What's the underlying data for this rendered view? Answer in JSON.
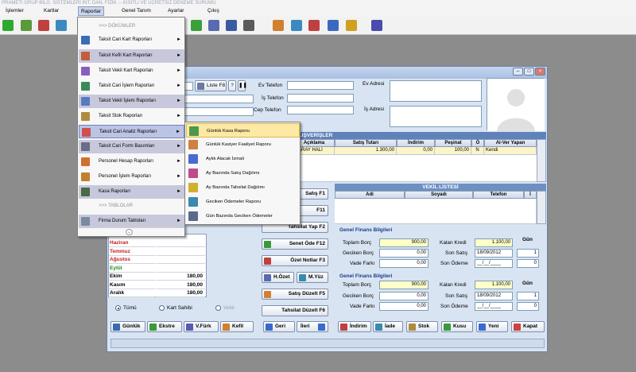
{
  "app": {
    "title": "PRAMETI GRUP BİLG. SİSTEMLERİ İNT. DAN. FİZM.  --  KISITLI VE ÜCRETSİZ DENEME SÜRÜMÜ"
  },
  "menubar": {
    "items": [
      "İşlemler",
      "Kartlar",
      "Raporlar",
      "Genel Tanım",
      "Ayarlar",
      "Çıkış"
    ]
  },
  "dropdown": {
    "items": [
      {
        "label": ">>> DÖKÜMLER",
        "type": "section"
      },
      {
        "label": "Taksit Cari Kart Raporları",
        "arrow": "►",
        "icon": "person-card-icon",
        "color": "#3a6db8"
      },
      {
        "label": "Taksit Kefil Kart Raporları",
        "arrow": "►",
        "icon": "people-icon",
        "color": "#c0603a"
      },
      {
        "label": "Taksit Vekil Kart Raporları",
        "arrow": "►",
        "icon": "person-icon",
        "color": "#8a5cc0"
      },
      {
        "label": "Taksit Cari İşlem Raporları",
        "arrow": "►",
        "icon": "transaction-icon",
        "color": "#3a8a5a"
      },
      {
        "label": "Taksit Vekil İşlem Raporları",
        "arrow": "►",
        "icon": "person-transaction-icon",
        "color": "#5a7ac0"
      },
      {
        "label": "Taksit Stok Raporları",
        "arrow": "►",
        "icon": "box-icon",
        "color": "#b08a40"
      },
      {
        "label": "Taksit Cari Analiz Raporları",
        "arrow": "►",
        "icon": "bar-chart-icon",
        "color": "#d05050"
      },
      {
        "label": "Taksit Cari Form Basımları",
        "arrow": "►",
        "icon": "printer-icon",
        "color": "#6b6b8a"
      },
      {
        "label": "Personel Hesap Raporları",
        "arrow": "►",
        "icon": "staff-icon",
        "color": "#d07030"
      },
      {
        "label": "Personel İşlem Raporları",
        "arrow": "►",
        "icon": "staff-transaction-icon",
        "color": "#c08030"
      },
      {
        "label": "Kasa Raporları",
        "arrow": "►",
        "icon": "cash-register-icon",
        "color": "#4a6a4a"
      },
      {
        "label": ">>> TABLOLAR",
        "type": "section"
      },
      {
        "label": "Firma Durum Tabloları",
        "arrow": "►",
        "icon": "table-icon",
        "color": "#7a8aa0"
      }
    ]
  },
  "submenu": {
    "items": [
      {
        "label": "Günlük Kasa Raporu",
        "icon": "cash-book-icon",
        "color": "#4a9a4a"
      },
      {
        "label": "Günlük Kasiyer Faaliyet Raporu",
        "icon": "cashier-icon",
        "color": "#d08040"
      },
      {
        "label": "Aylık Alacak İzmali",
        "icon": "calendar-grid-icon",
        "color": "#4a6ad0"
      },
      {
        "label": "Ay Bazında Satış Dağılımı",
        "icon": "pie-chart-icon",
        "color": "#c04a8a"
      },
      {
        "label": "Ay Bazında Tahsilat Dağılımı",
        "icon": "coins-icon",
        "color": "#d0b030"
      },
      {
        "label": "Geciken Ödemeler Raporu",
        "icon": "clock-icon",
        "color": "#3a8ab0"
      },
      {
        "label": "Gün Bazında Geciken Ödemeler",
        "icon": "list-icon",
        "color": "#5a6a8a"
      }
    ]
  },
  "customer": {
    "ev_telefon_label": "Ev Telefon",
    "is_telefon_label": "İş Telefon",
    "cep_telefon_label": "Cep Telefon",
    "ev_adresi_label": "Ev Adresi",
    "is_adresi_label": "İş Adresi",
    "liste_button": "Liste F8",
    "ev_telefon": "",
    "is_telefon": "",
    "cep_telefon": ""
  },
  "sales": {
    "band_title": "ALIŞVERİŞLER",
    "columns": [
      "Açıklama",
      "Satış Tutarı",
      "İndirim",
      "Peşinat",
      "Ö",
      "Al-Ver Yapan"
    ],
    "rows": [
      [
        "SARAY HALI",
        "1.300,00",
        "0,00",
        "100,00",
        "N",
        "Kendi"
      ]
    ]
  },
  "vekil": {
    "band_title": "VEKİL LİSTESİ",
    "columns": [
      "Adi",
      "Soyadı",
      "Telefon",
      "İ"
    ]
  },
  "actions": {
    "satis": "Satış  F1",
    "tahsilat": "Tahsilat Yap  F2",
    "senet_ode": "Senet Öde  F12",
    "ozel_notlar": "Özel Notlar  F3",
    "h_ozet": "H.Özet",
    "m_yuz": "M.Yüz",
    "satis_duzelt": "Satış  Düzelt F5",
    "tahsilat_duzelt": "Tahsilat Düzelt F6",
    "f11": "F11"
  },
  "months": [
    {
      "name": "Haziran",
      "value": "",
      "color": "#c02020"
    },
    {
      "name": "Temmuz",
      "value": "",
      "color": "#c02020"
    },
    {
      "name": "Ağustos",
      "value": "",
      "color": "#c02020"
    },
    {
      "name": "Eylül",
      "value": "",
      "color": "#1a8a1a"
    },
    {
      "name": "Ekim",
      "value": "180,00",
      "color": "#000"
    },
    {
      "name": "Kasım",
      "value": "180,00",
      "color": "#000"
    },
    {
      "name": "Aralık",
      "value": "180,00",
      "color": "#000"
    }
  ],
  "filter": {
    "tumu": "Tümü",
    "kart_sahibi": "Kart Sahibi",
    "vekil": "Vekil"
  },
  "bottom_left_buttons": [
    "Günlük",
    "Ekstre",
    "V.Fürk",
    "Kefil"
  ],
  "nav": {
    "geri": "Geri",
    "ileri": "İleri"
  },
  "bottom_right_buttons": [
    "İndirim",
    "İade",
    "Stok",
    "Kusu",
    "Yeni",
    "Kapat"
  ],
  "finance1": {
    "title": "Genel Finans Bilgileri",
    "toplam_borc_label": "Toplam Borç",
    "toplam_borc": "900,00",
    "geciken_borc_label": "Geciken Borç",
    "geciken_borc": "0,00",
    "vade_farki_label": "Vade Farkı",
    "vade_farki": "0,00",
    "kalan_kredi_label": "Kalan Kredi",
    "kalan_kredi": "1.100,00",
    "son_satis_label": "Son Satış",
    "son_satis": "18/09/2012",
    "son_odeme_label": "Son Ödeme",
    "son_odeme": "__/__/____",
    "gun_label": "Gün",
    "gun1": "1",
    "gun2": "0"
  },
  "finance2": {
    "title": "Genel Finans Bilgileri",
    "toplam_borc_label": "Toplam Borç",
    "toplam_borc": "900,00",
    "geciken_borc_label": "Geciken Borç",
    "geciken_borc": "0,00",
    "vade_farki_label": "Vade Farkı",
    "vade_farki": "0,00",
    "kalan_kredi_label": "Kalan Kredi",
    "kalan_kredi": "1.100,00",
    "son_satis_label": "Son Satış",
    "son_satis": "18/09/2012",
    "son_odeme_label": "Son Ödeme",
    "son_odeme": "__/__/____",
    "gun_label": "Gün",
    "gun1": "1",
    "gun2": "0"
  }
}
